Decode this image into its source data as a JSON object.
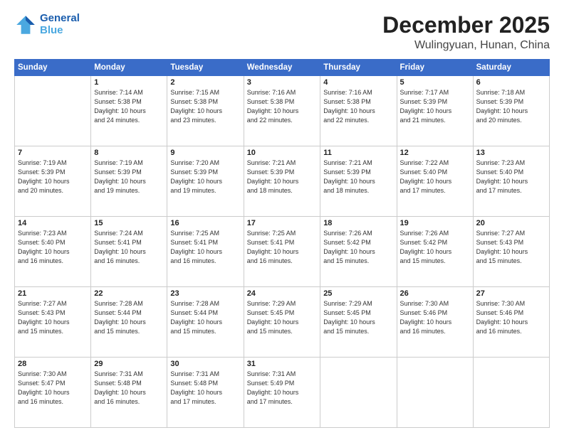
{
  "logo": {
    "line1": "General",
    "line2": "Blue"
  },
  "title": "December 2025",
  "location": "Wulingyuan, Hunan, China",
  "weekdays": [
    "Sunday",
    "Monday",
    "Tuesday",
    "Wednesday",
    "Thursday",
    "Friday",
    "Saturday"
  ],
  "weeks": [
    [
      {
        "day": "",
        "sunrise": "",
        "sunset": "",
        "daylight": ""
      },
      {
        "day": "1",
        "sunrise": "Sunrise: 7:14 AM",
        "sunset": "Sunset: 5:38 PM",
        "daylight": "Daylight: 10 hours and 24 minutes."
      },
      {
        "day": "2",
        "sunrise": "Sunrise: 7:15 AM",
        "sunset": "Sunset: 5:38 PM",
        "daylight": "Daylight: 10 hours and 23 minutes."
      },
      {
        "day": "3",
        "sunrise": "Sunrise: 7:16 AM",
        "sunset": "Sunset: 5:38 PM",
        "daylight": "Daylight: 10 hours and 22 minutes."
      },
      {
        "day": "4",
        "sunrise": "Sunrise: 7:16 AM",
        "sunset": "Sunset: 5:38 PM",
        "daylight": "Daylight: 10 hours and 22 minutes."
      },
      {
        "day": "5",
        "sunrise": "Sunrise: 7:17 AM",
        "sunset": "Sunset: 5:39 PM",
        "daylight": "Daylight: 10 hours and 21 minutes."
      },
      {
        "day": "6",
        "sunrise": "Sunrise: 7:18 AM",
        "sunset": "Sunset: 5:39 PM",
        "daylight": "Daylight: 10 hours and 20 minutes."
      }
    ],
    [
      {
        "day": "7",
        "sunrise": "Sunrise: 7:19 AM",
        "sunset": "Sunset: 5:39 PM",
        "daylight": "Daylight: 10 hours and 20 minutes."
      },
      {
        "day": "8",
        "sunrise": "Sunrise: 7:19 AM",
        "sunset": "Sunset: 5:39 PM",
        "daylight": "Daylight: 10 hours and 19 minutes."
      },
      {
        "day": "9",
        "sunrise": "Sunrise: 7:20 AM",
        "sunset": "Sunset: 5:39 PM",
        "daylight": "Daylight: 10 hours and 19 minutes."
      },
      {
        "day": "10",
        "sunrise": "Sunrise: 7:21 AM",
        "sunset": "Sunset: 5:39 PM",
        "daylight": "Daylight: 10 hours and 18 minutes."
      },
      {
        "day": "11",
        "sunrise": "Sunrise: 7:21 AM",
        "sunset": "Sunset: 5:39 PM",
        "daylight": "Daylight: 10 hours and 18 minutes."
      },
      {
        "day": "12",
        "sunrise": "Sunrise: 7:22 AM",
        "sunset": "Sunset: 5:40 PM",
        "daylight": "Daylight: 10 hours and 17 minutes."
      },
      {
        "day": "13",
        "sunrise": "Sunrise: 7:23 AM",
        "sunset": "Sunset: 5:40 PM",
        "daylight": "Daylight: 10 hours and 17 minutes."
      }
    ],
    [
      {
        "day": "14",
        "sunrise": "Sunrise: 7:23 AM",
        "sunset": "Sunset: 5:40 PM",
        "daylight": "Daylight: 10 hours and 16 minutes."
      },
      {
        "day": "15",
        "sunrise": "Sunrise: 7:24 AM",
        "sunset": "Sunset: 5:41 PM",
        "daylight": "Daylight: 10 hours and 16 minutes."
      },
      {
        "day": "16",
        "sunrise": "Sunrise: 7:25 AM",
        "sunset": "Sunset: 5:41 PM",
        "daylight": "Daylight: 10 hours and 16 minutes."
      },
      {
        "day": "17",
        "sunrise": "Sunrise: 7:25 AM",
        "sunset": "Sunset: 5:41 PM",
        "daylight": "Daylight: 10 hours and 16 minutes."
      },
      {
        "day": "18",
        "sunrise": "Sunrise: 7:26 AM",
        "sunset": "Sunset: 5:42 PM",
        "daylight": "Daylight: 10 hours and 15 minutes."
      },
      {
        "day": "19",
        "sunrise": "Sunrise: 7:26 AM",
        "sunset": "Sunset: 5:42 PM",
        "daylight": "Daylight: 10 hours and 15 minutes."
      },
      {
        "day": "20",
        "sunrise": "Sunrise: 7:27 AM",
        "sunset": "Sunset: 5:43 PM",
        "daylight": "Daylight: 10 hours and 15 minutes."
      }
    ],
    [
      {
        "day": "21",
        "sunrise": "Sunrise: 7:27 AM",
        "sunset": "Sunset: 5:43 PM",
        "daylight": "Daylight: 10 hours and 15 minutes."
      },
      {
        "day": "22",
        "sunrise": "Sunrise: 7:28 AM",
        "sunset": "Sunset: 5:44 PM",
        "daylight": "Daylight: 10 hours and 15 minutes."
      },
      {
        "day": "23",
        "sunrise": "Sunrise: 7:28 AM",
        "sunset": "Sunset: 5:44 PM",
        "daylight": "Daylight: 10 hours and 15 minutes."
      },
      {
        "day": "24",
        "sunrise": "Sunrise: 7:29 AM",
        "sunset": "Sunset: 5:45 PM",
        "daylight": "Daylight: 10 hours and 15 minutes."
      },
      {
        "day": "25",
        "sunrise": "Sunrise: 7:29 AM",
        "sunset": "Sunset: 5:45 PM",
        "daylight": "Daylight: 10 hours and 15 minutes."
      },
      {
        "day": "26",
        "sunrise": "Sunrise: 7:30 AM",
        "sunset": "Sunset: 5:46 PM",
        "daylight": "Daylight: 10 hours and 16 minutes."
      },
      {
        "day": "27",
        "sunrise": "Sunrise: 7:30 AM",
        "sunset": "Sunset: 5:46 PM",
        "daylight": "Daylight: 10 hours and 16 minutes."
      }
    ],
    [
      {
        "day": "28",
        "sunrise": "Sunrise: 7:30 AM",
        "sunset": "Sunset: 5:47 PM",
        "daylight": "Daylight: 10 hours and 16 minutes."
      },
      {
        "day": "29",
        "sunrise": "Sunrise: 7:31 AM",
        "sunset": "Sunset: 5:48 PM",
        "daylight": "Daylight: 10 hours and 16 minutes."
      },
      {
        "day": "30",
        "sunrise": "Sunrise: 7:31 AM",
        "sunset": "Sunset: 5:48 PM",
        "daylight": "Daylight: 10 hours and 17 minutes."
      },
      {
        "day": "31",
        "sunrise": "Sunrise: 7:31 AM",
        "sunset": "Sunset: 5:49 PM",
        "daylight": "Daylight: 10 hours and 17 minutes."
      },
      {
        "day": "",
        "sunrise": "",
        "sunset": "",
        "daylight": ""
      },
      {
        "day": "",
        "sunrise": "",
        "sunset": "",
        "daylight": ""
      },
      {
        "day": "",
        "sunrise": "",
        "sunset": "",
        "daylight": ""
      }
    ]
  ]
}
